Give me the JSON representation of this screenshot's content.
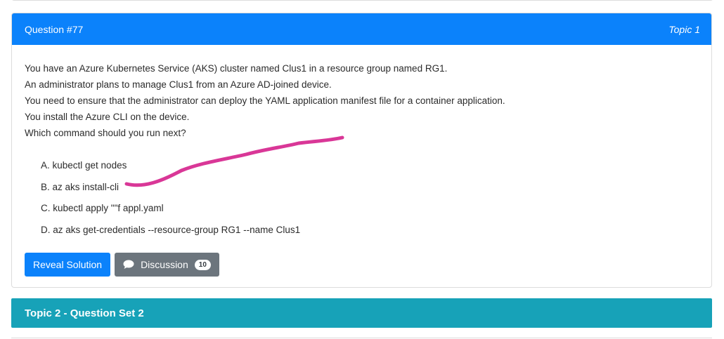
{
  "question": {
    "number_label": "Question #77",
    "topic_label": "Topic 1",
    "lines": [
      "You have an Azure Kubernetes Service (AKS) cluster named Clus1 in a resource group named RG1.",
      "An administrator plans to manage Clus1 from an Azure AD-joined device.",
      "You need to ensure that the administrator can deploy the YAML application manifest file for a container application.",
      "You install the Azure CLI on the device.",
      "Which command should you run next?"
    ],
    "choices": [
      "A. kubectl get nodes",
      "B. az aks install-cli",
      "C. kubectl apply \"\"f appl.yaml",
      "D. az aks get-credentials --resource-group RG1 --name Clus1"
    ]
  },
  "actions": {
    "reveal_label": "Reveal Solution",
    "discussion_label": "Discussion",
    "discussion_count": "10"
  },
  "topic_bar": {
    "label": "Topic 2 - Question Set 2"
  },
  "colors": {
    "header_blue": "#0b82fb",
    "topic_teal": "#17a2b8",
    "secondary_gray": "#6c757d",
    "annotation_magenta": "#d6268e"
  },
  "icons": {
    "discussion": "chat-bubble-icon"
  }
}
